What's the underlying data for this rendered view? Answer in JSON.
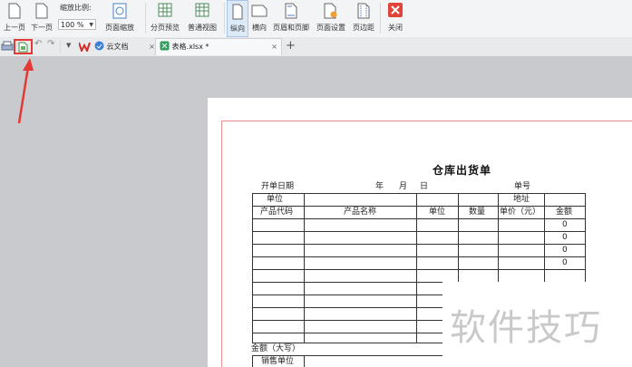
{
  "ribbon": {
    "prev_page": "上一页",
    "next_page": "下一页",
    "zoom_label": "缩放比例:",
    "zoom_value": "100 %",
    "page_zoom": "页面缩放",
    "page_break_preview": "分页预览",
    "normal_view": "普通视图",
    "portrait": "纵向",
    "landscape": "横向",
    "header_footer": "页眉和页脚",
    "page_setup": "页面设置",
    "margins": "页边距",
    "close": "关闭"
  },
  "tabs": {
    "cloud_doc": "云文档",
    "file_tab": "表格.xlsx *",
    "close_glyph": "×",
    "add_glyph": "+"
  },
  "sheet": {
    "title": "仓库出货单",
    "open_date": "开单日期",
    "year": "年",
    "month": "月",
    "day": "日",
    "doc_no": "单号",
    "unit": "单位",
    "address": "地址",
    "headers": [
      "产品代码",
      "产品名称",
      "单位",
      "数量",
      "单价（元）",
      "金额"
    ],
    "amounts": [
      "0",
      "0",
      "0",
      "0"
    ],
    "amount_words": "金额（大写）",
    "sales_unit": "销售单位"
  },
  "watermark": "软件技巧",
  "colors": {
    "annotation_red": "#e53935",
    "page_border": "#f08b8b",
    "active_blue": "#dce9f7"
  }
}
